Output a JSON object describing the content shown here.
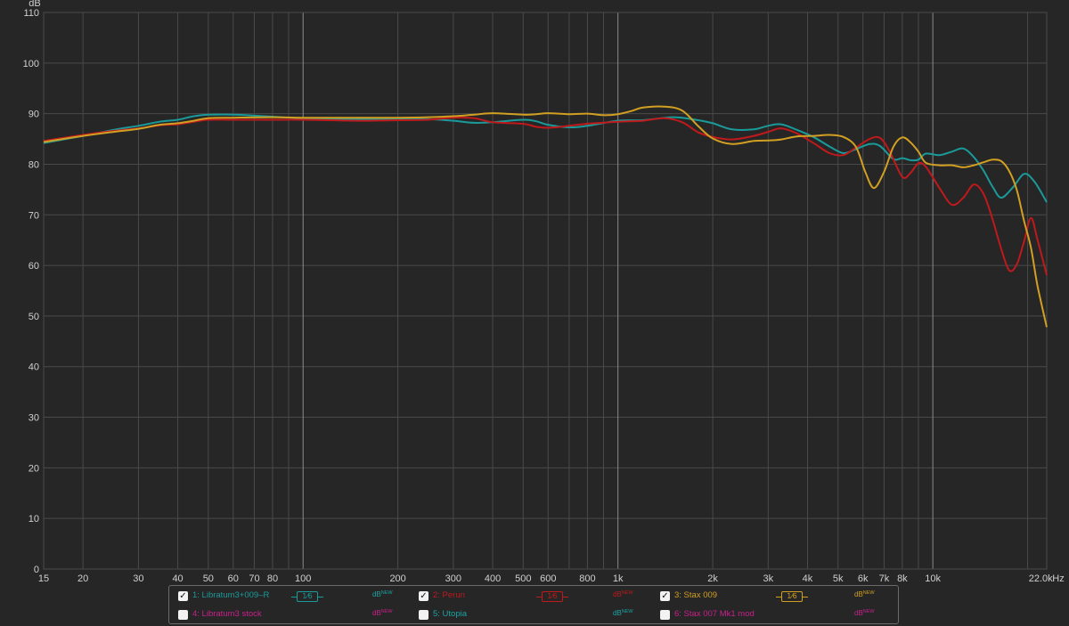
{
  "chart_data": {
    "type": "line",
    "y_unit_label": "dB",
    "x_unit_label": "Hz",
    "xlim": [
      15,
      23000
    ],
    "ylim": [
      0,
      110
    ],
    "x_scale": "log",
    "grid": true,
    "y_ticks": [
      "0",
      "10",
      "20",
      "30",
      "40",
      "50",
      "60",
      "70",
      "80",
      "90",
      "100",
      "110"
    ],
    "x_ticks": [
      {
        "value": 15,
        "label": "15"
      },
      {
        "value": 20,
        "label": "20"
      },
      {
        "value": 30,
        "label": "30"
      },
      {
        "value": 40,
        "label": "40"
      },
      {
        "value": 50,
        "label": "50"
      },
      {
        "value": 60,
        "label": "60"
      },
      {
        "value": 70,
        "label": "70"
      },
      {
        "value": 80,
        "label": "80"
      },
      {
        "value": 100,
        "label": "100"
      },
      {
        "value": 200,
        "label": "200"
      },
      {
        "value": 300,
        "label": "300"
      },
      {
        "value": 400,
        "label": "400"
      },
      {
        "value": 500,
        "label": "500"
      },
      {
        "value": 600,
        "label": "600"
      },
      {
        "value": 800,
        "label": "800"
      },
      {
        "value": 1000,
        "label": "1k"
      },
      {
        "value": 2000,
        "label": "2k"
      },
      {
        "value": 3000,
        "label": "3k"
      },
      {
        "value": 4000,
        "label": "4k"
      },
      {
        "value": 5000,
        "label": "5k"
      },
      {
        "value": 6000,
        "label": "6k"
      },
      {
        "value": 7000,
        "label": "7k"
      },
      {
        "value": 8000,
        "label": "8k"
      },
      {
        "value": 10000,
        "label": "10k"
      },
      {
        "value": 22000,
        "label": "22.0k"
      }
    ],
    "series": [
      {
        "name": "1: Libratum3+009–R",
        "color": "#1b9a9a",
        "points": [
          [
            15,
            84.2
          ],
          [
            20,
            85.6
          ],
          [
            25,
            86.8
          ],
          [
            30,
            87.6
          ],
          [
            35,
            88.4
          ],
          [
            40,
            88.8
          ],
          [
            45,
            89.5
          ],
          [
            50,
            89.8
          ],
          [
            60,
            89.8
          ],
          [
            70,
            89.6
          ],
          [
            80,
            89.4
          ],
          [
            100,
            89.1
          ],
          [
            150,
            88.9
          ],
          [
            200,
            89
          ],
          [
            250,
            88.9
          ],
          [
            300,
            88.6
          ],
          [
            350,
            88.2
          ],
          [
            400,
            88.3
          ],
          [
            500,
            88.8
          ],
          [
            550,
            88.5
          ],
          [
            600,
            87.8
          ],
          [
            700,
            87.3
          ],
          [
            800,
            87.6
          ],
          [
            1000,
            88.6
          ],
          [
            1200,
            88.7
          ],
          [
            1500,
            89.3
          ],
          [
            1800,
            88.7
          ],
          [
            2000,
            88.1
          ],
          [
            2300,
            86.9
          ],
          [
            2700,
            86.9
          ],
          [
            3000,
            87.6
          ],
          [
            3300,
            87.9
          ],
          [
            3700,
            86.8
          ],
          [
            4200,
            85.3
          ],
          [
            4700,
            83.5
          ],
          [
            5200,
            82.2
          ],
          [
            5700,
            83
          ],
          [
            6300,
            84
          ],
          [
            6800,
            83.6
          ],
          [
            7500,
            81
          ],
          [
            8000,
            81.2
          ],
          [
            8500,
            80.8
          ],
          [
            9000,
            80.9
          ],
          [
            9500,
            82.1
          ],
          [
            10500,
            81.8
          ],
          [
            11500,
            82.5
          ],
          [
            12500,
            83.1
          ],
          [
            13500,
            81.4
          ],
          [
            14500,
            78.7
          ],
          [
            15500,
            75.5
          ],
          [
            16500,
            73.4
          ],
          [
            18000,
            75.5
          ],
          [
            19500,
            78.1
          ],
          [
            21000,
            76.6
          ],
          [
            23000,
            72.5
          ]
        ]
      },
      {
        "name": "2: Perun",
        "color": "#c0191c",
        "points": [
          [
            15,
            84.6
          ],
          [
            20,
            85.8
          ],
          [
            25,
            86.6
          ],
          [
            30,
            87.1
          ],
          [
            35,
            87.7
          ],
          [
            40,
            87.9
          ],
          [
            45,
            88.4
          ],
          [
            50,
            88.8
          ],
          [
            60,
            88.8
          ],
          [
            80,
            88.8
          ],
          [
            100,
            88.8
          ],
          [
            150,
            88.6
          ],
          [
            200,
            88.7
          ],
          [
            250,
            88.8
          ],
          [
            300,
            89.2
          ],
          [
            350,
            89.1
          ],
          [
            400,
            88.3
          ],
          [
            500,
            88
          ],
          [
            550,
            87.4
          ],
          [
            600,
            87.2
          ],
          [
            700,
            87.6
          ],
          [
            800,
            88
          ],
          [
            1000,
            88.4
          ],
          [
            1200,
            88.6
          ],
          [
            1400,
            89.1
          ],
          [
            1600,
            88.3
          ],
          [
            1800,
            86.3
          ],
          [
            2000,
            85.4
          ],
          [
            2300,
            84.9
          ],
          [
            2700,
            85.6
          ],
          [
            3000,
            86.4
          ],
          [
            3300,
            87.1
          ],
          [
            3700,
            86.1
          ],
          [
            4200,
            84.1
          ],
          [
            4700,
            82.2
          ],
          [
            5200,
            81.8
          ],
          [
            5700,
            83.3
          ],
          [
            6300,
            85
          ],
          [
            6800,
            85.2
          ],
          [
            7300,
            82.5
          ],
          [
            8000,
            77.5
          ],
          [
            8500,
            78.3
          ],
          [
            9000,
            80.2
          ],
          [
            9500,
            79.5
          ],
          [
            10500,
            75.3
          ],
          [
            11500,
            72
          ],
          [
            12500,
            73.4
          ],
          [
            13500,
            76
          ],
          [
            14500,
            74.1
          ],
          [
            15500,
            69
          ],
          [
            16500,
            63.2
          ],
          [
            17500,
            59
          ],
          [
            18500,
            60.3
          ],
          [
            19500,
            64.8
          ],
          [
            20500,
            69.4
          ],
          [
            21500,
            65.1
          ],
          [
            23000,
            58.1
          ]
        ]
      },
      {
        "name": "3: Stax 009",
        "color": "#d19f22",
        "points": [
          [
            15,
            84.4
          ],
          [
            20,
            85.6
          ],
          [
            25,
            86.4
          ],
          [
            30,
            87
          ],
          [
            35,
            87.8
          ],
          [
            40,
            88.1
          ],
          [
            45,
            88.6
          ],
          [
            50,
            89.1
          ],
          [
            60,
            89.2
          ],
          [
            80,
            89.3
          ],
          [
            100,
            89.2
          ],
          [
            150,
            89.2
          ],
          [
            200,
            89.2
          ],
          [
            250,
            89.3
          ],
          [
            300,
            89.5
          ],
          [
            350,
            89.8
          ],
          [
            400,
            90.1
          ],
          [
            500,
            89.8
          ],
          [
            550,
            89.9
          ],
          [
            600,
            90.1
          ],
          [
            700,
            89.9
          ],
          [
            800,
            90
          ],
          [
            900,
            89.7
          ],
          [
            1000,
            89.9
          ],
          [
            1100,
            90.5
          ],
          [
            1200,
            91.2
          ],
          [
            1400,
            91.4
          ],
          [
            1600,
            90.6
          ],
          [
            1800,
            87.5
          ],
          [
            2000,
            85.1
          ],
          [
            2300,
            84
          ],
          [
            2700,
            84.6
          ],
          [
            3000,
            84.7
          ],
          [
            3300,
            84.9
          ],
          [
            3700,
            85.5
          ],
          [
            4200,
            85.6
          ],
          [
            4700,
            85.8
          ],
          [
            5200,
            85.4
          ],
          [
            5700,
            83.4
          ],
          [
            6100,
            78.5
          ],
          [
            6500,
            75.3
          ],
          [
            7000,
            78.5
          ],
          [
            7500,
            83.5
          ],
          [
            8000,
            85.3
          ],
          [
            8500,
            84.3
          ],
          [
            9000,
            82.5
          ],
          [
            9500,
            80.3
          ],
          [
            10500,
            79.8
          ],
          [
            11500,
            79.8
          ],
          [
            12500,
            79.4
          ],
          [
            13500,
            79.8
          ],
          [
            14500,
            80.4
          ],
          [
            15500,
            80.9
          ],
          [
            16500,
            80.6
          ],
          [
            17500,
            78.6
          ],
          [
            18500,
            74.8
          ],
          [
            19500,
            68.7
          ],
          [
            20500,
            63.5
          ],
          [
            21500,
            56
          ],
          [
            23000,
            47.8
          ]
        ]
      }
    ]
  },
  "legend": [
    {
      "index": "1",
      "name": "1: Libratum3+009–R",
      "checked": true,
      "color": "#1b9a9a",
      "smoothing": "1⁄6",
      "db_label": "dB",
      "db_sup": "NEW",
      "db_color": "#1ba3a3"
    },
    {
      "index": "2",
      "name": "2: Perun",
      "checked": true,
      "color": "#c0191c",
      "smoothing": "1⁄6",
      "db_label": "dB",
      "db_sup": "NEW",
      "db_color": "#c0191c"
    },
    {
      "index": "3",
      "name": "3: Stax 009",
      "checked": true,
      "color": "#d19f22",
      "smoothing": "1⁄6",
      "db_label": "dB",
      "db_sup": "NEW",
      "db_color": "#d19f22"
    },
    {
      "index": "4",
      "name": "4: Libratum3 stock",
      "checked": false,
      "color": "#c8208c",
      "db_label": "dB",
      "db_sup": "NEW",
      "db_color": "#c8208c"
    },
    {
      "index": "5",
      "name": "5: Utopia",
      "checked": false,
      "color": "#1ba3a3",
      "db_label": "dB",
      "db_sup": "NEW",
      "db_color": "#1ba3a3"
    },
    {
      "index": "6",
      "name": "6: Stax 007 Mk1 mod",
      "checked": false,
      "color": "#c8208c",
      "db_label": "dB",
      "db_sup": "NEW",
      "db_color": "#c8208c"
    }
  ],
  "colors": {
    "background": "#262626",
    "grid": "#4a4a4a",
    "grid_major": "#8a8a8a",
    "axis_text": "#d0d0d0"
  }
}
